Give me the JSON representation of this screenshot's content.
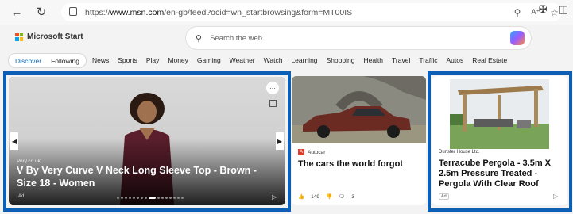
{
  "browser": {
    "url_prefix": "https://",
    "url_host": "www.msn.com",
    "url_path": "/en-gb/feed?ocid=wn_startbrowsing&form=MT00IS"
  },
  "header": {
    "logo_text": "Microsoft Start",
    "search_placeholder": "Search the web",
    "brand_colors": [
      "#f25022",
      "#7fba00",
      "#00a4ef",
      "#ffb900"
    ]
  },
  "tabs": [
    {
      "label": "Discover",
      "active": true
    },
    {
      "label": "Following",
      "active": false
    }
  ],
  "categories": [
    "News",
    "Sports",
    "Play",
    "Money",
    "Gaming",
    "Weather",
    "Watch",
    "Learning",
    "Shopping",
    "Health",
    "Travel",
    "Traffic",
    "Autos",
    "Real Estate"
  ],
  "hero": {
    "source": "Very.co.uk",
    "title": "V By Very Curve V Neck Long Sleeve Top - Brown - Size 18 - Women",
    "ad_label": "Ad",
    "more": "···",
    "carousel_dots": 16,
    "carousel_active": 8
  },
  "car_article": {
    "source": "Autocar",
    "title": "The cars the world forgot",
    "likes": "149",
    "comments": "3"
  },
  "pergola_ad": {
    "source": "Dunster House Ltd.",
    "title": "Terracube Pergola - 3.5m X 2.5m Pressure Treated - Pergola With Clear Roof",
    "ad_label": "Ad"
  },
  "selection_color": "#0c5fb4"
}
